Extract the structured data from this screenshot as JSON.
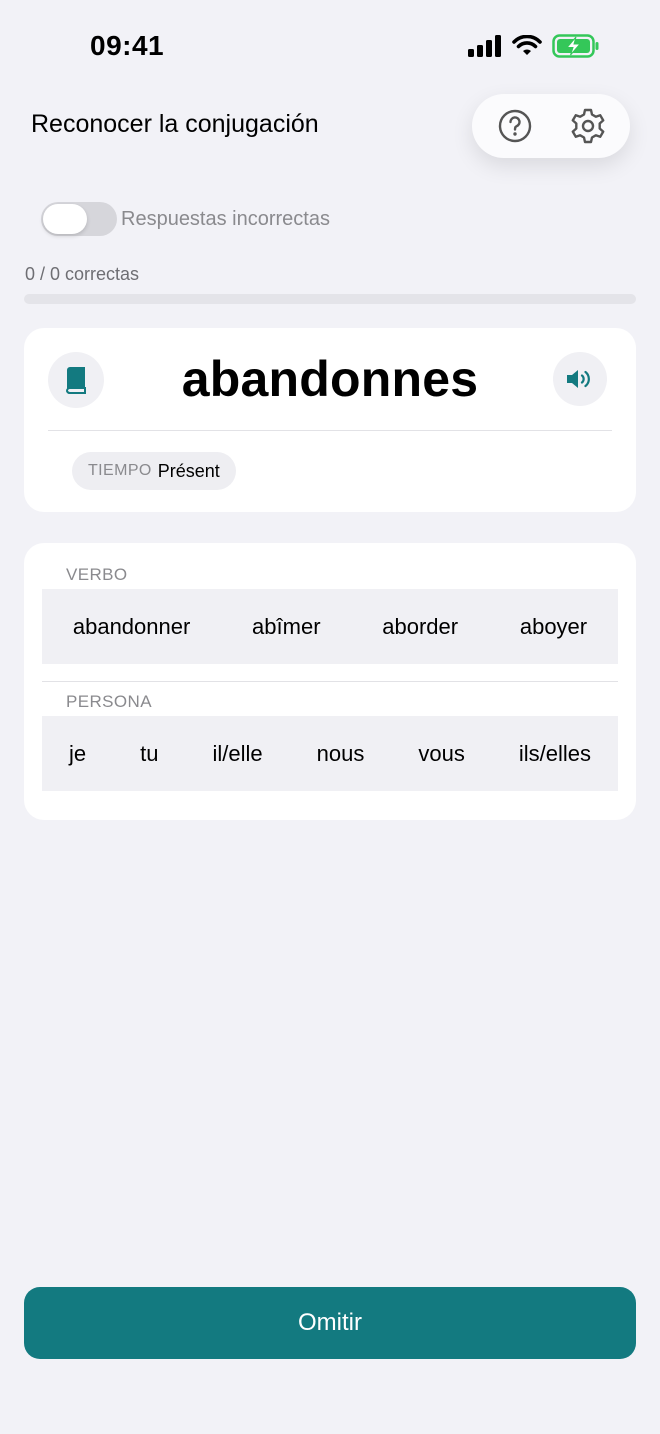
{
  "status_bar": {
    "time": "09:41"
  },
  "header": {
    "title": "Reconocer la conjugación"
  },
  "toggle": {
    "label": "Respuestas incorrectas",
    "on": false
  },
  "progress": {
    "text": "0 / 0 correctas",
    "fraction": 0
  },
  "word_card": {
    "word": "abandonnes",
    "tense_key": "TIEMPO",
    "tense_value": "Présent"
  },
  "answers": {
    "verb_label": "VERBO",
    "verbs": [
      "abandonner",
      "abîmer",
      "aborder",
      "aboyer"
    ],
    "person_label": "PERSONA",
    "persons": [
      "je",
      "tu",
      "il/elle",
      "nous",
      "vous",
      "ils/elles"
    ]
  },
  "footer": {
    "omit_label": "Omitir"
  },
  "colors": {
    "accent": "#137a80",
    "background": "#f2f2f7",
    "battery": "#34c759"
  },
  "icons": {
    "help": "question-circle-icon",
    "settings": "gear-icon",
    "dictionary": "book-icon",
    "audio": "speaker-icon"
  }
}
